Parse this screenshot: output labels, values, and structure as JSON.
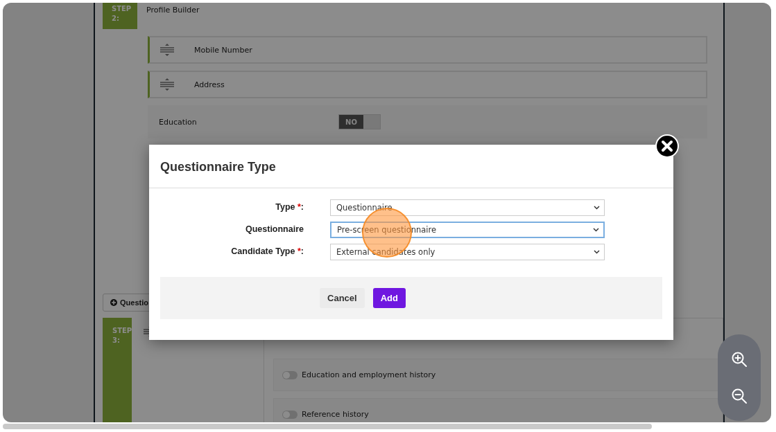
{
  "profile_step": {
    "step_label": "STEP",
    "step_number": "2:",
    "title": "Profile Builder",
    "fields": [
      {
        "label": "Mobile Number"
      },
      {
        "label": "Address"
      }
    ],
    "toggle_row": {
      "label": "Education",
      "toggle_text": "NO",
      "on": false
    }
  },
  "add_button": {
    "label": "Questio"
  },
  "history_step": {
    "step_label": "STEP",
    "step_number": "3:",
    "options": [
      {
        "label": "Education and employment history",
        "on": false
      },
      {
        "label": "Reference history",
        "on": false
      }
    ]
  },
  "modal": {
    "title": "Questionnaire Type",
    "fields": [
      {
        "label": "Type",
        "mark": "*",
        "end": ":",
        "value": "Questionnaire",
        "focused": false
      },
      {
        "label": "Questionnaire",
        "value": "Pre-screen questionnaire",
        "focused": true
      },
      {
        "label": "Candidate Type",
        "mark": "*",
        "end": ":",
        "value": "External candidates only",
        "focused": false
      }
    ],
    "buttons": [
      {
        "label": "Cancel",
        "kind": "secondary"
      },
      {
        "label": "Add",
        "kind": "primary"
      }
    ]
  }
}
